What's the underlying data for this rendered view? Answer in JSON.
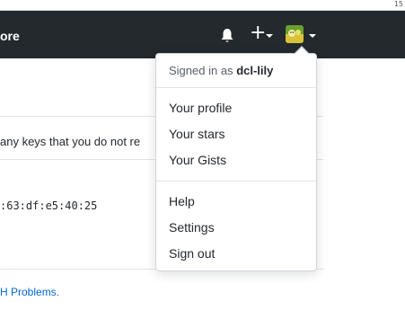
{
  "colors": {
    "header_bg": "#24292e",
    "link": "#0366d6",
    "accent_green": "#2ea44f",
    "text": "#24292e",
    "muted": "#586069"
  },
  "topstrip": {
    "text": "15"
  },
  "header": {
    "nav_partial": "ore",
    "icons": {
      "notifications": "bell-icon",
      "create": "plus-icon",
      "avatar": "avatar-image"
    }
  },
  "main": {
    "warning_partial": "any keys that you do not re",
    "fingerprint_partial": ":63:df:e5:40:25",
    "help_link_partial": "H Problems."
  },
  "dropdown": {
    "signed_in_prefix": "Signed in as",
    "username": "dcl-lily",
    "group1": [
      {
        "label": "Your profile"
      },
      {
        "label": "Your stars"
      },
      {
        "label": "Your Gists"
      }
    ],
    "group2": [
      {
        "label": "Help"
      },
      {
        "label": "Settings"
      },
      {
        "label": "Sign out"
      }
    ]
  }
}
